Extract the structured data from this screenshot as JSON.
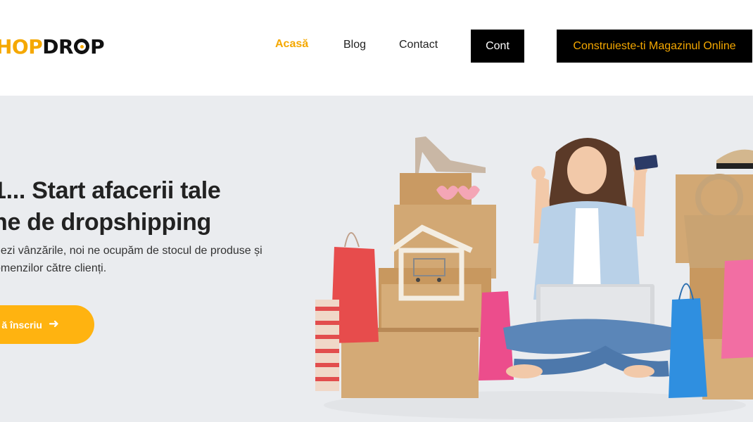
{
  "header": {
    "logo_part1": "HOP",
    "logo_part2a": "DR",
    "logo_part2b": "P",
    "nav": {
      "home": "Acasă",
      "blog": "Blog",
      "contact": "Contact"
    },
    "account_button": "Cont",
    "build_store_button": "Construieste-ti Magazinul Online"
  },
  "hero": {
    "title_line1": "1... Start afacerii tale",
    "title_line2": "ne de dropshipping",
    "subtitle_line1": "nezi vânzările, noi ne ocupăm de stocul de produse și",
    "subtitle_line2": "omenzilor către clienți.",
    "cta_label": "ă înscriu",
    "cta_icon": "arrow-right-icon"
  },
  "colors": {
    "accent": "#f5a800",
    "cta": "#ffb310",
    "hero_bg": "#eaecef",
    "dark": "#000000"
  }
}
